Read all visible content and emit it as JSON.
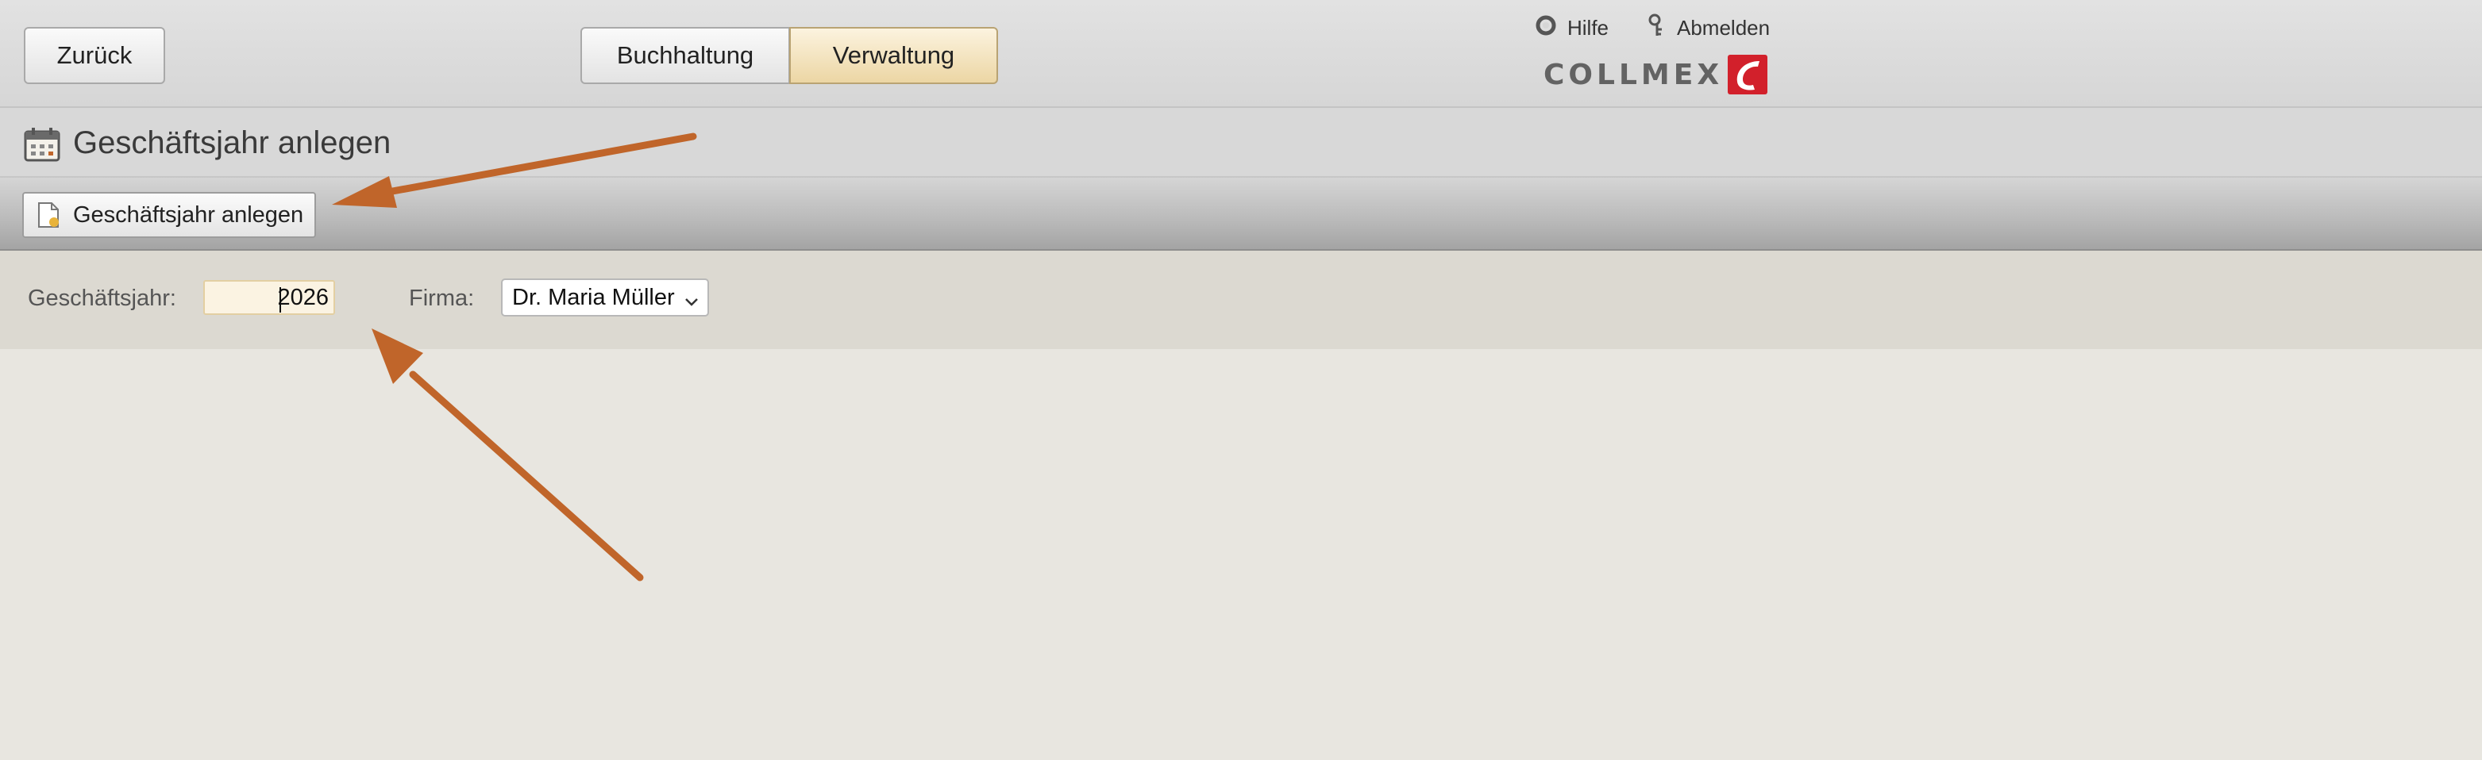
{
  "topbar": {
    "back_label": "Zurück",
    "tabs": [
      {
        "label": "Buchhaltung",
        "active": false
      },
      {
        "label": "Verwaltung",
        "active": true
      }
    ],
    "help_label": "Hilfe",
    "logout_label": "Abmelden",
    "logo_text": "COLLMEX",
    "help_icon": "lifebuoy-icon",
    "logout_icon": "key-icon"
  },
  "page": {
    "title": "Geschäftsjahr anlegen",
    "title_icon": "calendar-icon"
  },
  "toolbar": {
    "create_label": "Geschäftsjahr anlegen",
    "create_icon": "new-document-icon"
  },
  "form": {
    "year_label": "Geschäftsjahr:",
    "year_value": "2026",
    "firma_label": "Firma:",
    "firma_value": "Dr. Maria Müller"
  },
  "colors": {
    "accent_tab": "#ecd6a4",
    "annotation_arrow": "#c0652a",
    "brand_red": "#d2202b"
  }
}
